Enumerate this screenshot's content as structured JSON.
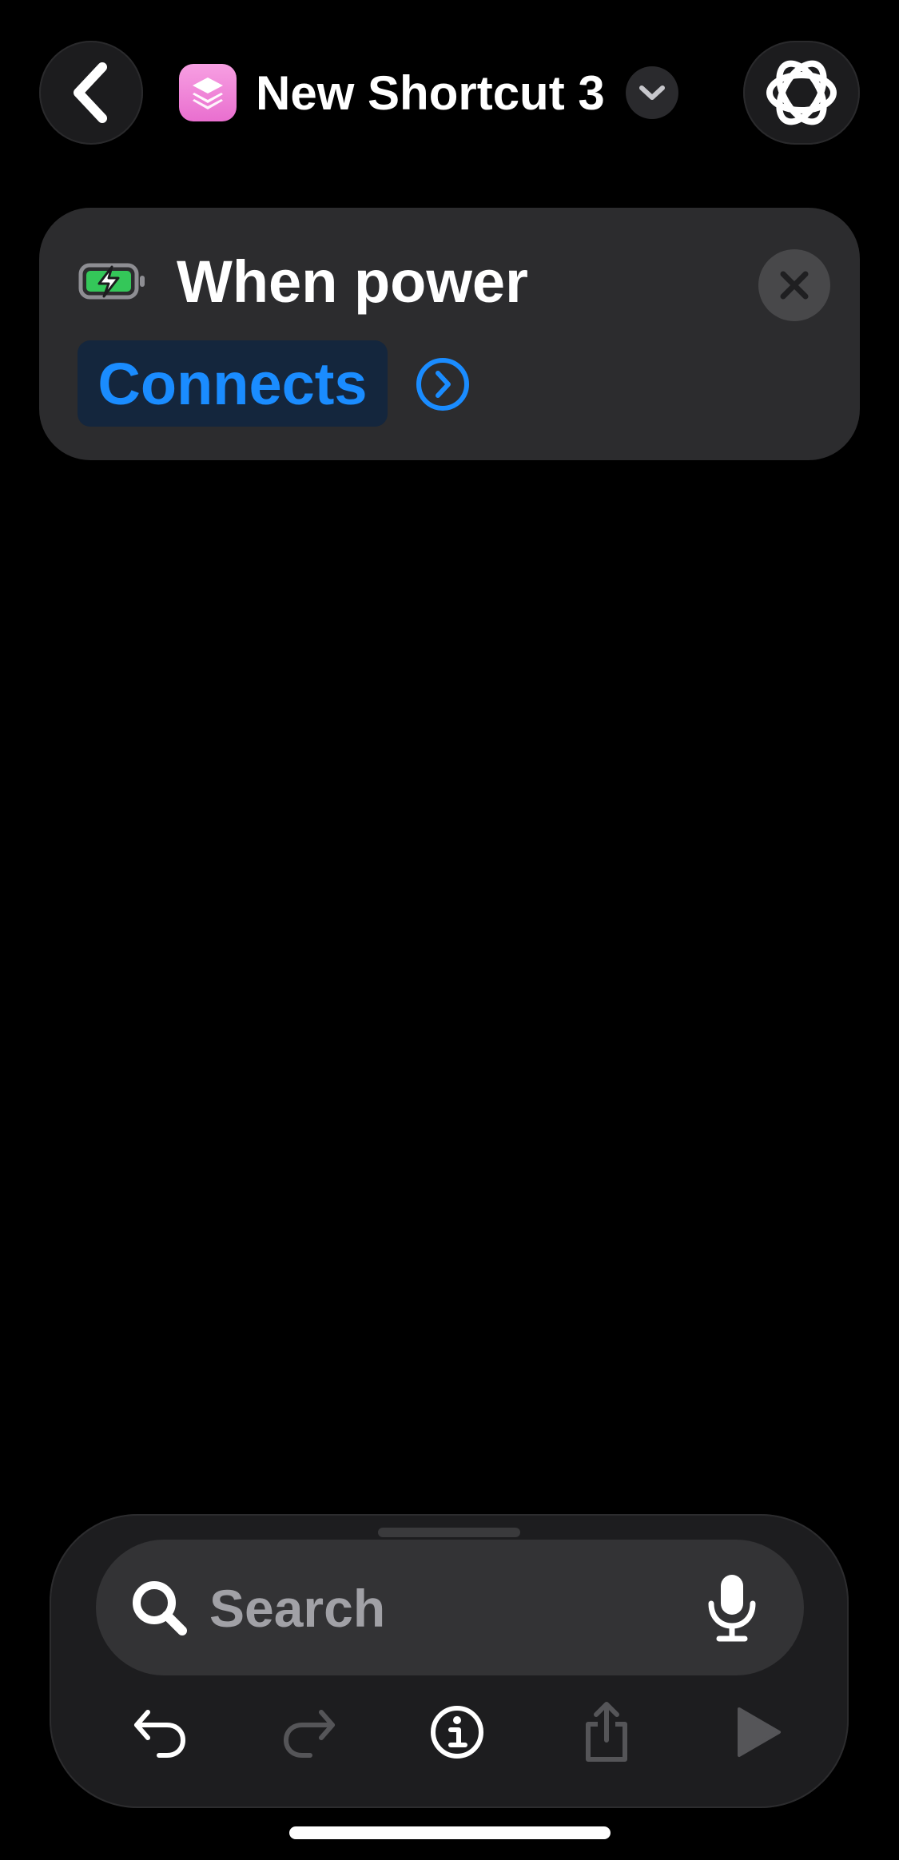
{
  "header": {
    "back_icon": "chevron-left-icon",
    "app_icon": "shortcuts-layers-icon",
    "app_icon_color": "#ef86d9",
    "title": "New Shortcut 3",
    "title_menu_icon": "chevron-down-icon",
    "assistant_icon": "apple-intelligence-icon"
  },
  "trigger_card": {
    "icon": "battery-charging-icon",
    "battery_color": "#34c759",
    "title": "When power",
    "parameter": "Connects",
    "parameter_color": "#1a8cff",
    "expand_icon": "chevron-right-circle-icon",
    "remove_icon": "close-icon"
  },
  "bottom_panel": {
    "search_placeholder": "Search",
    "search_icon": "search-icon",
    "mic_icon": "microphone-icon",
    "toolbar": {
      "undo_icon": "undo-icon",
      "redo_icon": "redo-icon",
      "info_icon": "info-icon",
      "share_icon": "share-icon",
      "run_icon": "play-icon"
    }
  }
}
